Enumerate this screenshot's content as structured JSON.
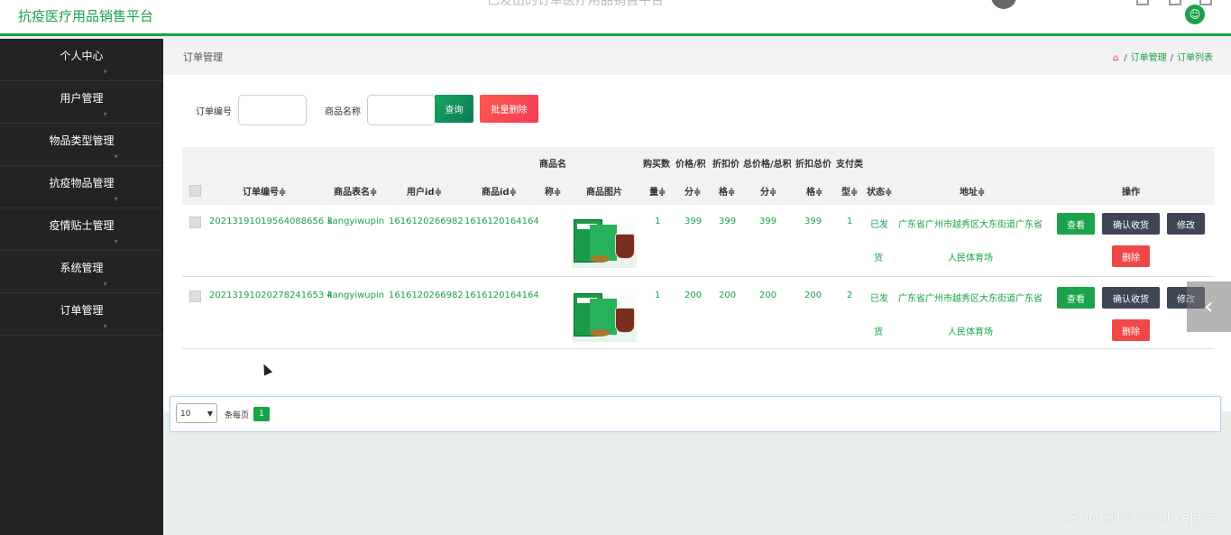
{
  "header": {
    "brand": "抗疫医疗用品销售平台",
    "window_title": "已发出的订单医疗用品销售平台",
    "user_icon": "user-icon"
  },
  "sidebar": {
    "items": [
      {
        "label": "个人中心"
      },
      {
        "label": "用户管理"
      },
      {
        "label": "物品类型管理"
      },
      {
        "label": "抗疫物品管理"
      },
      {
        "label": "疫情贴士管理"
      },
      {
        "label": "系统管理"
      },
      {
        "label": "订单管理"
      }
    ]
  },
  "breadcrumb": {
    "page_title": "订单管理",
    "home_icon": "home-icon",
    "level1": "订单管理",
    "level2": "订单列表"
  },
  "search": {
    "order_no_label": "订单编号",
    "order_no_value": "",
    "product_name_label": "商品名称",
    "product_name_value": "",
    "query_button": "查询",
    "bulk_delete_button": "批量删除"
  },
  "table": {
    "headers": {
      "order_no": "订单编号",
      "table_name": "商品表名",
      "user_id": "用户id",
      "product_id": "商品id",
      "product_name_top": "商品名",
      "product_name_bottom": "称",
      "product_image": "商品图片",
      "qty_top": "购买数",
      "qty_bottom": "量",
      "price_top": "价格/积",
      "price_bottom": "分",
      "discount_price_top": "折扣价",
      "discount_price_bottom": "格",
      "total_top": "总价格/总积",
      "total_bottom": "分",
      "discount_total_top": "折扣总价",
      "discount_total_bottom": "格",
      "pay_type_top": "支付类",
      "pay_type_bottom": "型",
      "status": "状态",
      "address": "地址",
      "actions": "操作",
      "sort_icon": "≑"
    },
    "rows": [
      {
        "order_no": "20213191019564088656 3",
        "table_name": "kangyiwupin",
        "user_id": "1616120266982",
        "product_id": "1616120164164",
        "qty": "1",
        "price": "399",
        "discount_price": "399",
        "total": "399",
        "discount_total": "399",
        "pay_type": "1",
        "status_line1": "已发",
        "status_line2": "货",
        "address_line1": "广东省广州市越秀区大东街道广东省",
        "address_line2": "人民体育场"
      },
      {
        "order_no": "20213191020278241653 4",
        "table_name": "kangyiwupin",
        "user_id": "1616120266982",
        "product_id": "1616120164164",
        "qty": "1",
        "price": "200",
        "discount_price": "200",
        "total": "200",
        "discount_total": "200",
        "pay_type": "2",
        "status_line1": "已发",
        "status_line2": "货",
        "address_line1": "广东省广州市越秀区大东街道广东省",
        "address_line2": "人民体育场"
      }
    ],
    "actions": {
      "view": "查看",
      "confirm": "确认收货",
      "edit": "修改",
      "delete": "删除"
    }
  },
  "pagination": {
    "page_size": "10",
    "per_page_label": "条每页",
    "current_page": "1"
  },
  "watermark": "CSDN @haoyanlikeJava",
  "carousel_icon": "chevron-left-icon",
  "colors": {
    "accent": "#1aa34a",
    "sidebar_bg": "#232323",
    "danger": "#f04848",
    "dark_button": "#3e4656"
  }
}
